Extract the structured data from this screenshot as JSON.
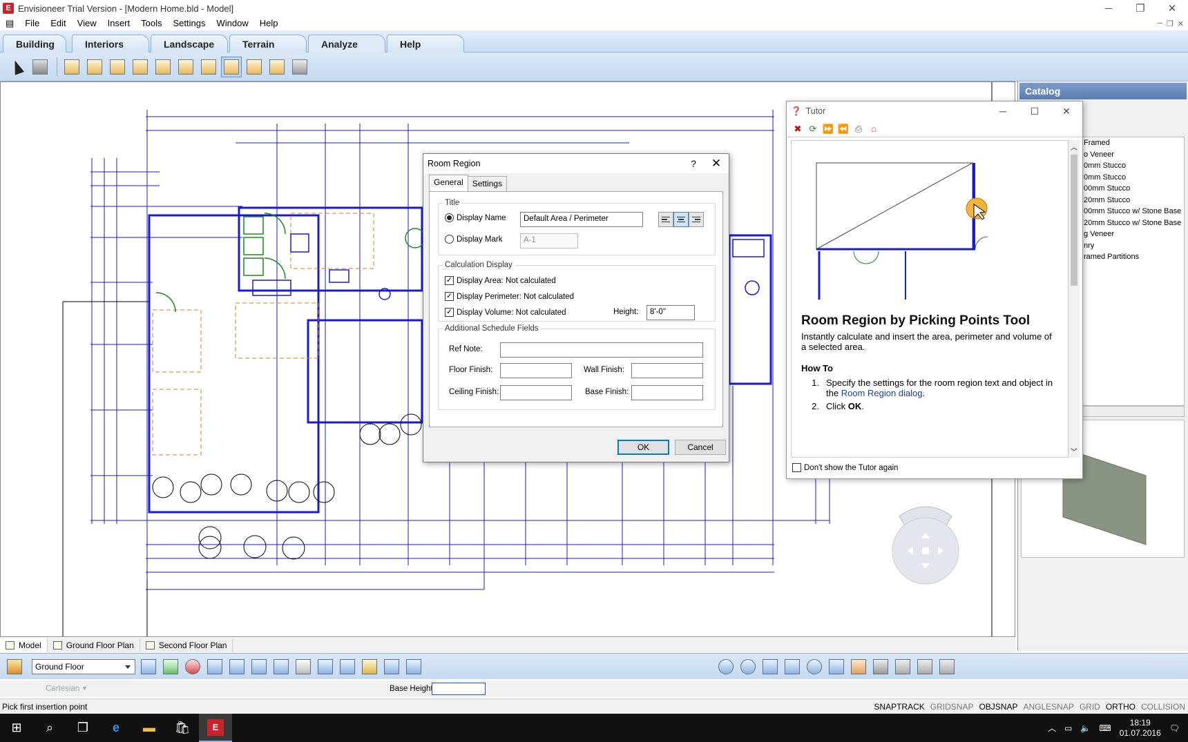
{
  "window": {
    "title": "Envisioneer Trial Version - [Modern Home.bld - Model]",
    "app_icon": "E"
  },
  "menu": [
    "File",
    "Edit",
    "View",
    "Insert",
    "Tools",
    "Settings",
    "Window",
    "Help"
  ],
  "ribbon_tabs": [
    {
      "label": "Building"
    },
    {
      "label": "Interiors"
    },
    {
      "label": "Landscape"
    },
    {
      "label": "Terrain"
    },
    {
      "label": "Analyze",
      "active": true
    },
    {
      "label": "Help"
    }
  ],
  "catalog": {
    "title": "Catalog",
    "items": [
      "Framed",
      "o Veneer",
      "0mm Stucco",
      "0mm Stucco",
      "00mm Stucco",
      "20mm Stucco",
      "00mm Stucco w/ Stone Base",
      "20mm Stucco w/ Stone Base",
      "g Veneer",
      "nry",
      "ramed Partitions"
    ]
  },
  "dialog": {
    "title": "Room Region",
    "help": "?",
    "close": "✕",
    "tabs": [
      "General",
      "Settings"
    ],
    "title_group": {
      "legend": "Title",
      "display_name_label": "Display Name",
      "display_name_value": "Default Area / Perimeter",
      "display_mark_label": "Display Mark",
      "display_mark_value": "A-1"
    },
    "calc_group": {
      "legend": "Calculation Display",
      "area": "Display Area: Not calculated",
      "perimeter": "Display Perimeter: Not calculated",
      "volume": "Display Volume: Not calculated",
      "height_label": "Height:",
      "height_value": "8'-0\""
    },
    "schedule_group": {
      "legend": "Additional Schedule Fields",
      "ref_note": "Ref Note:",
      "floor_finish": "Floor Finish:",
      "wall_finish": "Wall Finish:",
      "ceiling_finish": "Ceiling Finish:",
      "base_finish": "Base Finish:"
    },
    "ok": "OK",
    "cancel": "Cancel"
  },
  "tutor": {
    "title": "Tutor",
    "heading": "Room Region by Picking Points Tool",
    "description": "Instantly calculate and insert the area, perimeter and volume of a selected area.",
    "how_to": "How To",
    "step1_num": "1.",
    "step1_text": "Specify the settings for the room region text and object in the ",
    "step1_link": "Room Region dialog",
    "step1_end": ".",
    "step2_num": "2.",
    "step2_text": "Click ",
    "step2_bold": "OK",
    "step2_end": ".",
    "dont_show": "Don't show the Tutor again"
  },
  "bottom_tabs": [
    {
      "label": "Model",
      "active": true
    },
    {
      "label": "Ground Floor Plan"
    },
    {
      "label": "Second Floor Plan"
    }
  ],
  "floor_select": "Ground Floor",
  "coords": {
    "system": "Cartesian",
    "base_height_label": "Base Height"
  },
  "status": {
    "prompt": "Pick first insertion point",
    "snaps": [
      {
        "label": "SNAPTRACK",
        "on": true
      },
      {
        "label": "GRIDSNAP",
        "on": false
      },
      {
        "label": "OBJSNAP",
        "on": true
      },
      {
        "label": "ANGLESNAP",
        "on": false
      },
      {
        "label": "GRID",
        "on": false
      },
      {
        "label": "ORTHO",
        "on": true
      },
      {
        "label": "COLLISION",
        "on": false
      }
    ]
  },
  "clock": {
    "time": "18:19",
    "date": "01.07.2016"
  }
}
